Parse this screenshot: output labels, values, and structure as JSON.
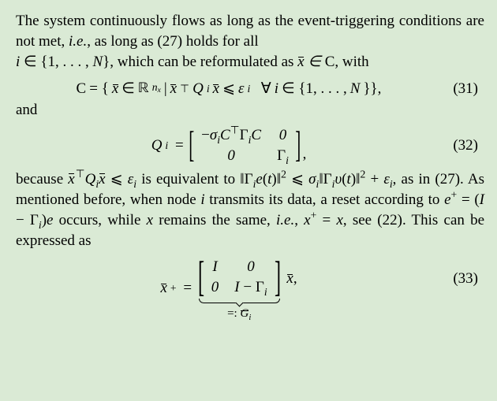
{
  "para1a": "The system continuously flows as long as the event-triggering conditions are not met, ",
  "ie": "i.e.",
  "para1b": ", as long as (27) holds for all",
  "para1c": ", which can be reformulated as ",
  "iinset": "i ∈ {1, . . . , N}",
  "xbarinC": ", with",
  "eq31lhs": "C",
  "eq31eq": " = ",
  "eq31body": "{ x̄ ∈ ℝⁿˣ | x̄ᵀQᵢ x̄ ⩽ εᵢ  ∀ i ∈ {1, . . . , N} },",
  "eq31num": "(31)",
  "and": "and",
  "eq32lhs": "Q",
  "eq32i": "i",
  "eq32eq": " = ",
  "m32_11": "−σᵢCᵀΓᵢC",
  "m32_12": "0",
  "m32_21": "0",
  "m32_22": "Γᵢ",
  "eq32comma": ",",
  "eq32num": "(32)",
  "para2a": "because ",
  "para2b": " is equivalent to ",
  "para2c": ", as in (27). As mentioned before, when node ",
  "para2d": " transmits its data, a reset according to ",
  "para2e": " occurs, while ",
  "para2f": " remains the same, ",
  "para2g": ", see (22). This can be expressed as",
  "ineq1": "x̄ᵀQᵢ x̄ ⩽ εᵢ",
  "norm1": "‖Γᵢe(t)‖² ⩽ σᵢ‖Γᵢυ(t)‖² + εᵢ",
  "nodei": "i",
  "reset": "e⁺ = (I − Γᵢ)e",
  "xvar": "x",
  "xplus": "x⁺ = x",
  "eq33lhs": "x̄",
  "eq33plus": "+",
  "eq33eq": " = ",
  "m33_11": "I",
  "m33_12": "0",
  "m33_21": "0",
  "m33_22": "I − Γᵢ",
  "eq33rhs": " x̄,",
  "eq33num": "(33)",
  "ublabel": "=: G̅ᵢ",
  "chart_data": null
}
